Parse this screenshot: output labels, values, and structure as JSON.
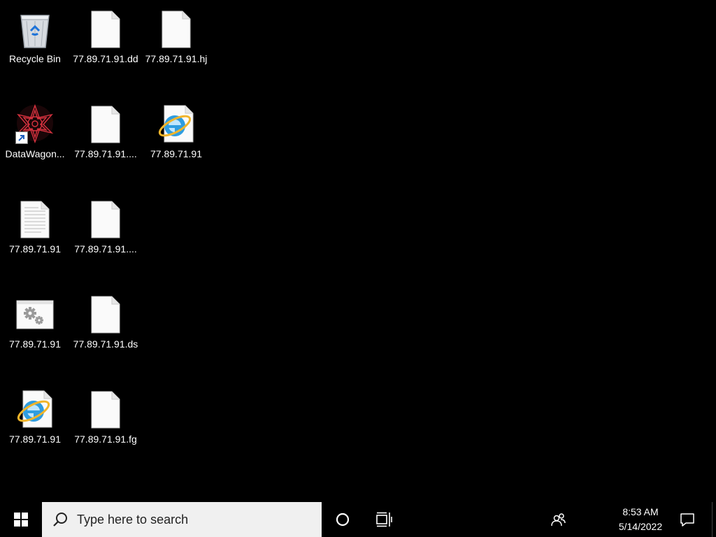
{
  "desktop": {
    "icons": [
      {
        "label": "Recycle Bin",
        "icon": "recycle-bin-icon"
      },
      {
        "label": "77.89.71.91.dd",
        "icon": "blank-file-icon"
      },
      {
        "label": "77.89.71.91.hj",
        "icon": "blank-file-icon"
      },
      {
        "label": "DataWagon...",
        "icon": "datawagon-app-icon"
      },
      {
        "label": "77.89.71.91....",
        "icon": "blank-file-icon"
      },
      {
        "label": "77.89.71.91",
        "icon": "internet-explorer-file-icon"
      },
      {
        "label": "77.89.71.91",
        "icon": "text-document-icon"
      },
      {
        "label": "77.89.71.91....",
        "icon": "blank-file-icon"
      },
      {
        "label": "77.89.71.91",
        "icon": "settings-file-icon"
      },
      {
        "label": "77.89.71.91.ds",
        "icon": "blank-file-icon"
      },
      {
        "label": "77.89.71.91",
        "icon": "internet-explorer-file-icon"
      },
      {
        "label": "77.89.71.91.fg",
        "icon": "blank-file-icon"
      }
    ]
  },
  "taskbar": {
    "search_placeholder": "Type here to search",
    "time": "8:53 AM",
    "date": "5/14/2022",
    "colors": {
      "background": "#000000",
      "search_bg": "#f0f0f0"
    }
  }
}
